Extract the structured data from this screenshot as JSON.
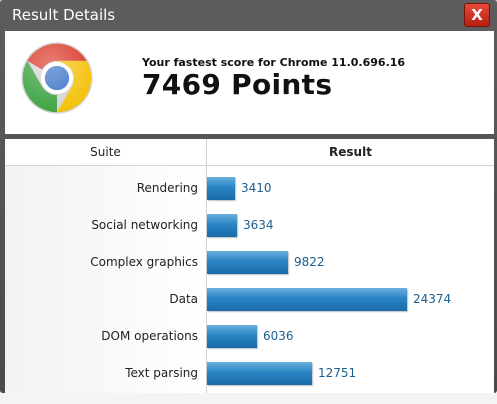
{
  "window": {
    "title": "Result Details",
    "close_label": "X"
  },
  "score": {
    "label": "Your fastest score for Chrome 11.0.696.16",
    "value": "7469 Points"
  },
  "table": {
    "headers": {
      "suite": "Suite",
      "result": "Result"
    },
    "max_value": 24374,
    "rows": [
      {
        "suite": "Rendering",
        "value": 3410,
        "display": "3410"
      },
      {
        "suite": "Social networking",
        "value": 3634,
        "display": "3634"
      },
      {
        "suite": "Complex graphics",
        "value": 9822,
        "display": "9822"
      },
      {
        "suite": "Data",
        "value": 24374,
        "display": "24374"
      },
      {
        "suite": "DOM operations",
        "value": 6036,
        "display": "6036"
      },
      {
        "suite": "Text parsing",
        "value": 12751,
        "display": "12751"
      }
    ]
  },
  "colors": {
    "bar": "#2a84c4",
    "value_text": "#1b5e8f",
    "dialog_frame": "#4f4f4f",
    "close_button": "#d0392b"
  }
}
